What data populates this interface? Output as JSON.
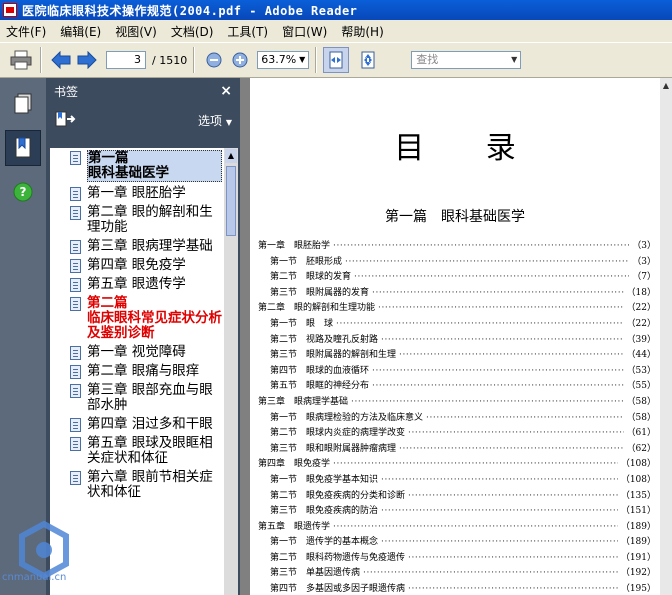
{
  "window": {
    "title": "医院临床眼科技术操作规范(2004.pdf - Adobe Reader"
  },
  "menu": [
    "文件(F)",
    "编辑(E)",
    "视图(V)",
    "文档(D)",
    "工具(T)",
    "窗口(W)",
    "帮助(H)"
  ],
  "toolbar": {
    "page_current": "3",
    "page_total": "/ 1510",
    "zoom": "63.7%",
    "search_placeholder": "查找"
  },
  "bookmarks": {
    "header": "书签",
    "close": "×",
    "options_label": "选项",
    "items": [
      {
        "label": "第一篇\n眼科基础医学",
        "style": "selected"
      },
      {
        "label": "第一章 眼胚胎学",
        "style": "normal"
      },
      {
        "label": "第二章 眼的解剖和生理功能",
        "style": "normal"
      },
      {
        "label": "第三章 眼病理学基础",
        "style": "normal"
      },
      {
        "label": "第四章 眼免疫学",
        "style": "normal"
      },
      {
        "label": "第五章 眼遗传学",
        "style": "normal"
      },
      {
        "label": "第二篇\n临床眼科常见症状分析及鉴别诊断",
        "style": "red"
      },
      {
        "label": "第一章 视觉障碍",
        "style": "normal"
      },
      {
        "label": "第二章 眼痛与眼痒",
        "style": "normal"
      },
      {
        "label": "第三章 眼部充血与眼部水肿",
        "style": "normal"
      },
      {
        "label": "第四章 泪过多和干眼",
        "style": "normal"
      },
      {
        "label": "第五章 眼球及眼眶相关症状和体征",
        "style": "normal"
      },
      {
        "label": "第六章 眼前节相关症状和体征",
        "style": "normal"
      }
    ]
  },
  "document": {
    "title": "目 录",
    "part_title": "第一篇　眼科基础医学",
    "toc": [
      {
        "label": "第一章　眼胚胎学",
        "page": "（3）",
        "level": "chap"
      },
      {
        "label": "第一节　胚眼形成",
        "page": "（3）",
        "level": "sec"
      },
      {
        "label": "第二节　眼球的发育",
        "page": "（7）",
        "level": "sec"
      },
      {
        "label": "第三节　眼附属器的发育",
        "page": "（18）",
        "level": "sec"
      },
      {
        "label": "第二章　眼的解剖和生理功能",
        "page": "（22）",
        "level": "chap"
      },
      {
        "label": "第一节　眼　球",
        "page": "（22）",
        "level": "sec"
      },
      {
        "label": "第二节　视路及瞳孔反射路",
        "page": "（39）",
        "level": "sec"
      },
      {
        "label": "第三节　眼附属器的解剖和生理",
        "page": "（44）",
        "level": "sec"
      },
      {
        "label": "第四节　眼球的血液循环",
        "page": "（53）",
        "level": "sec"
      },
      {
        "label": "第五节　眼眶的神经分布",
        "page": "（55）",
        "level": "sec"
      },
      {
        "label": "第三章　眼病理学基础",
        "page": "（58）",
        "level": "chap"
      },
      {
        "label": "第一节　眼病理检验的方法及临床意义",
        "page": "（58）",
        "level": "sec"
      },
      {
        "label": "第二节　眼球内炎症的病理学改变",
        "page": "（61）",
        "level": "sec"
      },
      {
        "label": "第三节　眼和眼附属器肿瘤病理",
        "page": "（62）",
        "level": "sec"
      },
      {
        "label": "第四章　眼免疫学",
        "page": "（108）",
        "level": "chap"
      },
      {
        "label": "第一节　眼免疫学基本知识",
        "page": "（108）",
        "level": "sec"
      },
      {
        "label": "第二节　眼免疫疾病的分类和诊断",
        "page": "（135）",
        "level": "sec"
      },
      {
        "label": "第三节　眼免疫疾病的防治",
        "page": "（151）",
        "level": "sec"
      },
      {
        "label": "第五章　眼遗传学",
        "page": "（189）",
        "level": "chap"
      },
      {
        "label": "第一节　遗传学的基本概念",
        "page": "（189）",
        "level": "sec"
      },
      {
        "label": "第二节　眼科药物遗传与免疫遗传",
        "page": "（191）",
        "level": "sec"
      },
      {
        "label": "第三节　单基因遗传病",
        "page": "（192）",
        "level": "sec"
      },
      {
        "label": "第四节　多基因或多因子眼遗传病",
        "page": "（195）",
        "level": "sec"
      }
    ]
  },
  "watermark_text": "cnmanual.cn"
}
